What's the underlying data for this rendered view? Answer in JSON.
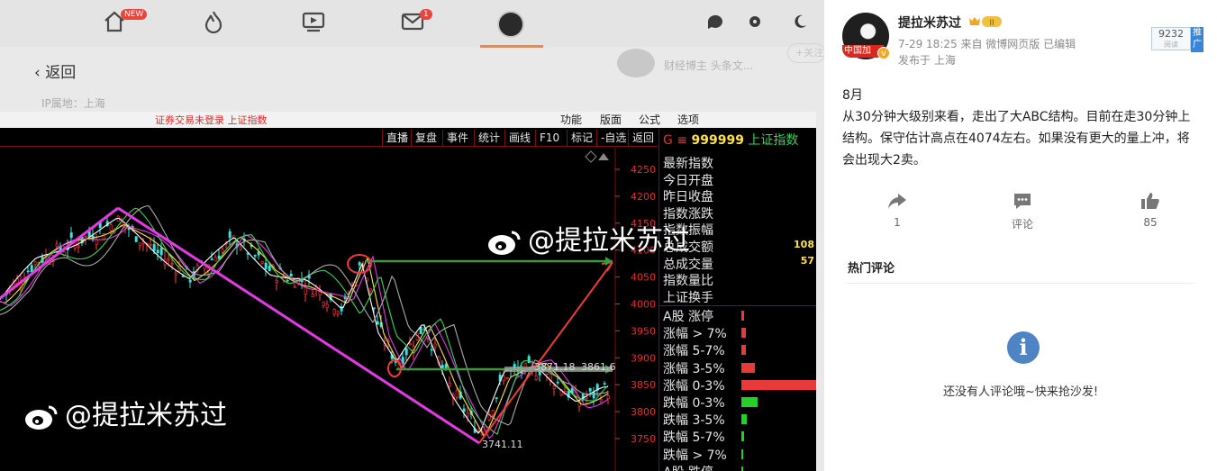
{
  "nav": {
    "new_badge": "NEW",
    "mail_badge": "1",
    "back_label": "返回",
    "ip_label": "IP属地：上海",
    "peek_text": "财经博主 头条文...",
    "peek_follow": "+关注"
  },
  "software": {
    "warning": "证券交易未登录",
    "title": "上证指数",
    "menu": [
      "功能",
      "版面",
      "公式",
      "选项"
    ],
    "toolbar": [
      "直播",
      "复盘",
      "事件",
      "统计",
      "画线",
      "F10",
      "标记",
      "-自选",
      "返回"
    ],
    "y_ticks": [
      "4250",
      "4200",
      "4150",
      "4100",
      "4050",
      "4000",
      "3950",
      "3900",
      "3850",
      "3800",
      "3750"
    ],
    "annotations": {
      "low": "3741.11",
      "level_a": "3871.18",
      "level_b": "3861.6"
    },
    "quote": {
      "g_mark": "G",
      "eq": "≡",
      "code": "999999",
      "name": "上证指数",
      "rows": [
        "最新指数",
        "今日开盘",
        "昨日收盘",
        "指数涨跌",
        "指数振幅",
        "总成交额",
        "总成交量",
        "指数量比",
        "上证换手"
      ],
      "val_1": "108",
      "val_2": "57",
      "breadth": [
        "A股 涨停",
        "涨幅 > 7%",
        "涨幅 5-7%",
        "涨幅 3-5%",
        "涨幅 0-3%",
        "跌幅 0-3%",
        "跌幅 3-5%",
        "跌幅 5-7%",
        "跌幅 > 7%",
        "A股 跌停"
      ],
      "breadth_levels": [
        0.02,
        0.03,
        0.03,
        0.1,
        0.55,
        0.12,
        0.04,
        0.02,
        0.01,
        0.01
      ],
      "breadth_colors": [
        "#e83a3a",
        "#e83a3a",
        "#e83a3a",
        "#e83a3a",
        "#e83a3a",
        "#22d22a",
        "#22d22a",
        "#22d22a",
        "#22d22a",
        "#22d22a"
      ]
    },
    "watermark": "@提拉米苏过"
  },
  "post": {
    "username": "提拉米苏过",
    "level_badge": "II",
    "avatar_strip": "中国加",
    "time_source": "7-29 18:25  来自 微博网页版 已编辑",
    "location": "发布于 上海",
    "reads": "9232",
    "reads_label": "阅读",
    "promote": "推广",
    "month": "8月",
    "body": "从30分钟大级别来看，走出了大ABC结构。目前在走30分钟上结构。保守估计高点在4074左右。如果没有更大的量上冲，将会出现大2卖。",
    "repost_count": "1",
    "comment_label": "评论",
    "like_count": "85",
    "hot_comments": "热门评论",
    "empty_comments": "还没有人评论哦~快来抢沙发!"
  }
}
